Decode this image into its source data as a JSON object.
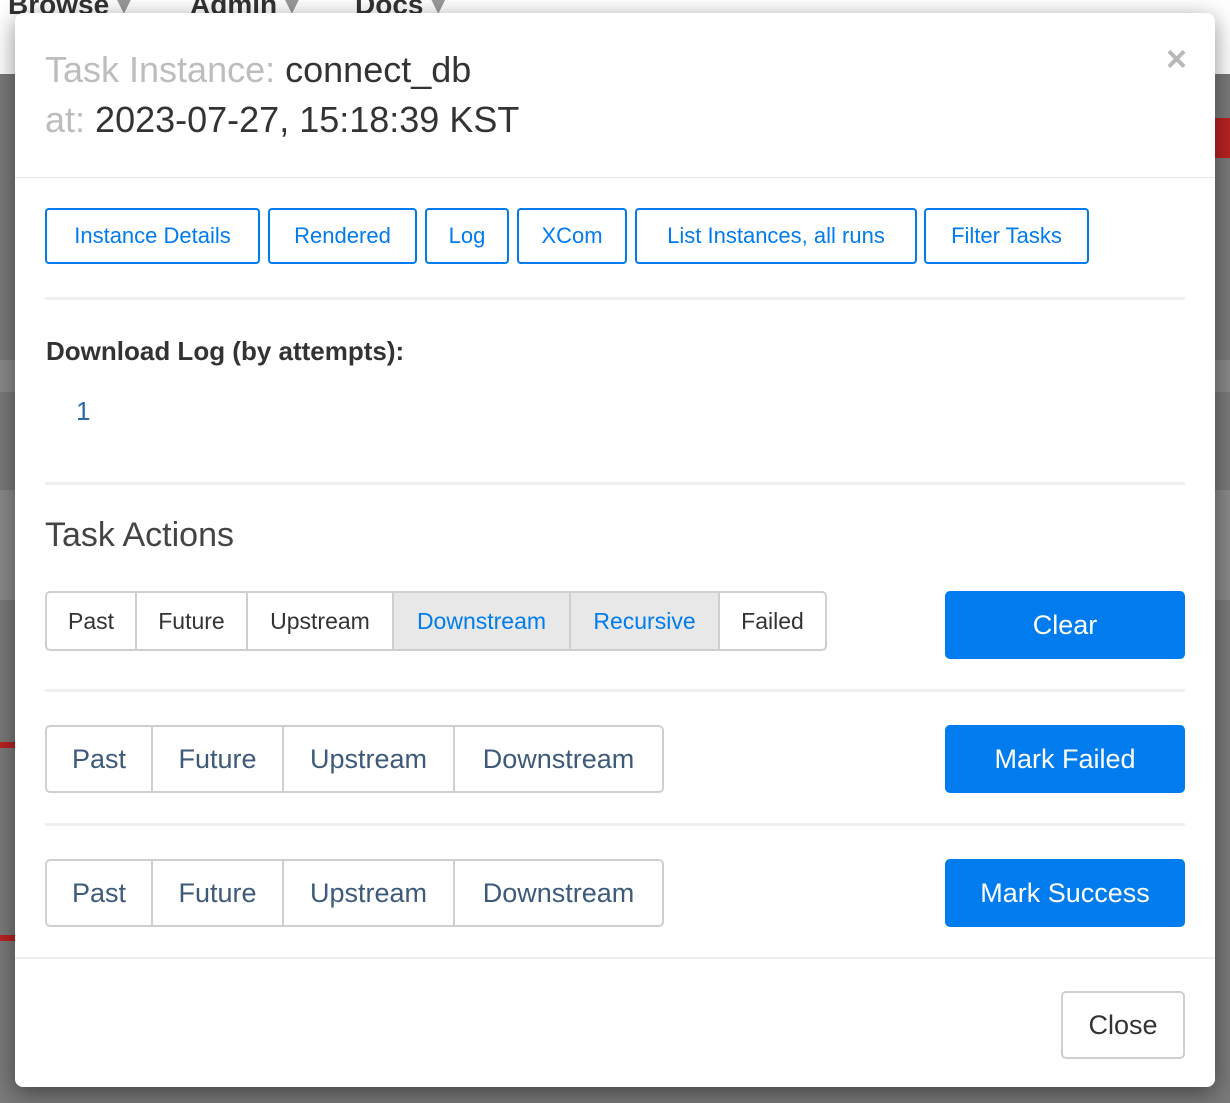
{
  "background_nav": {
    "items": [
      "Browse",
      "Admin",
      "Docs"
    ]
  },
  "modal": {
    "title_prefix": "Task Instance:",
    "task_id": "connect_db",
    "at_prefix": "at:",
    "execution_date": "2023-07-27, 15:18:39 KST",
    "close_icon_glyph": "×",
    "nav_buttons": [
      "Instance Details",
      "Rendered",
      "Log",
      "XCom",
      "List Instances, all runs",
      "Filter Tasks"
    ],
    "download_log_title": "Download Log (by attempts):",
    "download_attempts": [
      "1"
    ],
    "task_actions_title": "Task Actions",
    "clear_options": [
      {
        "label": "Past",
        "active": false
      },
      {
        "label": "Future",
        "active": false
      },
      {
        "label": "Upstream",
        "active": false
      },
      {
        "label": "Downstream",
        "active": true
      },
      {
        "label": "Recursive",
        "active": true
      },
      {
        "label": "Failed",
        "active": false
      }
    ],
    "clear_button": "Clear",
    "mark_failed_options": [
      "Past",
      "Future",
      "Upstream",
      "Downstream"
    ],
    "mark_failed_button": "Mark Failed",
    "mark_success_options": [
      "Past",
      "Future",
      "Upstream",
      "Downstream"
    ],
    "mark_success_button": "Mark Success",
    "footer_close_button": "Close"
  },
  "colors": {
    "accent": "#017cee",
    "active_toggle_bg": "#e8e8e8",
    "muted_title": "#bdbdbd"
  }
}
